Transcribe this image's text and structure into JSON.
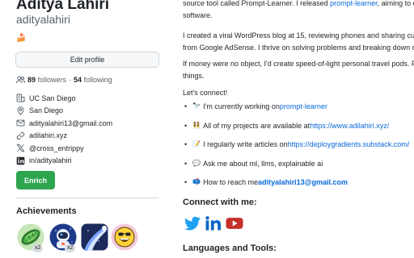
{
  "profile": {
    "name": "Aditya Lahiri",
    "login": "adityalahiri",
    "status_emoji": "🍰",
    "edit_label": "Edit profile",
    "followers_count": "89",
    "followers_label": "followers",
    "separator": "·",
    "following_count": "54",
    "following_label": "following",
    "details": [
      {
        "icon": "organization-icon",
        "text": "UC San Diego"
      },
      {
        "icon": "location-icon",
        "text": "San Diego"
      },
      {
        "icon": "mail-icon",
        "text": "adityalahiri13@gmail.com"
      },
      {
        "icon": "link-icon",
        "text": "adilahiri.xyz"
      },
      {
        "icon": "x-logo-icon",
        "text": "@cross_entrippy"
      },
      {
        "icon": "linkedin-icon",
        "text": "in/adityalahiri"
      }
    ],
    "enrich_label": "Enrich",
    "achievements_title": "Achievements",
    "achievements": [
      {
        "icon": "peas-badge-icon",
        "count": "x2"
      },
      {
        "icon": "astronaut-badge-icon",
        "count": "x2"
      },
      {
        "icon": "comet-badge-icon",
        "count": ""
      },
      {
        "icon": "grinning-face-badge-icon",
        "count": ""
      }
    ]
  },
  "readme": {
    "intro_line1_pre": "source tool called Prompt-Learner. I released ",
    "intro_line1_link": "prompt-learner",
    "intro_line1_post": ", aiming to en",
    "intro_line2": "software.",
    "para2_line1": "I created a viral WordPress blog at 15, reviewing phones and sharing custo",
    "para2_line2": "from Google AdSense. I thrive on solving problems and breaking down con",
    "para3_line1": "If money were no object, I'd create speed-of-light personal travel pods. Fo",
    "para3_line2": "things.",
    "connect_line": "Let's connect!",
    "items": [
      {
        "emoji": "🔭",
        "text": "I'm currently working on ",
        "link": "prompt-learner"
      },
      {
        "emoji": "👯",
        "text": "All of my projects are available at ",
        "link": "https://www.adilahiri.xyz/"
      },
      {
        "emoji": "📝",
        "text": "I regularly write articles on ",
        "link": "https://deploygradients.substack.com/"
      },
      {
        "emoji": "💬",
        "text": "Ask me about ml, llms, explainable ai",
        "link": ""
      },
      {
        "emoji": "📫",
        "text": "How to reach me ",
        "link": "adityalahiri13@gmail.com"
      }
    ],
    "connect_heading": "Connect with me:",
    "socials": [
      "twitter-icon",
      "linkedin-icon",
      "youtube-icon"
    ],
    "languages_heading": "Languages and Tools:"
  },
  "colors": {
    "link": "#0969da",
    "enrich": "#2da44e",
    "twitter": "#1da1f2",
    "linkedin": "#0a66c2",
    "youtube": "#c4302b"
  }
}
